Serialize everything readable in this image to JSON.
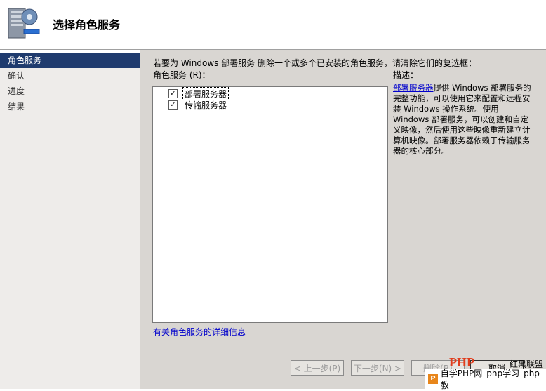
{
  "header": {
    "title": "选择角色服务"
  },
  "sidebar": {
    "items": [
      {
        "label": "角色服务",
        "active": true
      },
      {
        "label": "确认",
        "active": false
      },
      {
        "label": "进度",
        "active": false
      },
      {
        "label": "结果",
        "active": false
      }
    ]
  },
  "main": {
    "instruction": "若要为 Windows 部署服务 删除一个或多个已安装的角色服务，请清除它们的复选框：",
    "list_label": "角色服务 (R)：",
    "role_services": [
      {
        "label": "部署服务器",
        "checked": true,
        "focused": true
      },
      {
        "label": "传输服务器",
        "checked": true,
        "focused": false
      }
    ],
    "description_label": "描述：",
    "description_link": "部署服务器",
    "description_text": "提供 Windows 部署服务的完整功能，可以使用它来配置和远程安装 Windows 操作系统。使用 Windows 部署服务，可以创建和自定义映像，然后使用这些映像重新建立计算机映像。部署服务器依赖于传输服务器的核心部分。",
    "more_info_link": "有关角色服务的详细信息"
  },
  "buttons": {
    "previous": "< 上一步(P)",
    "next": "下一步(N) >",
    "remove": "删除(R)",
    "cancel": "取消"
  },
  "watermark": {
    "text": "自学PHP网_php学习_php教",
    "brand": "PHP",
    "top_text": "红黑联盟"
  },
  "colors": {
    "accent": "#1f3b6e",
    "sidebar_bg": "#eeecea",
    "panel_bg": "#d9d6d2",
    "link": "#0000cc"
  }
}
